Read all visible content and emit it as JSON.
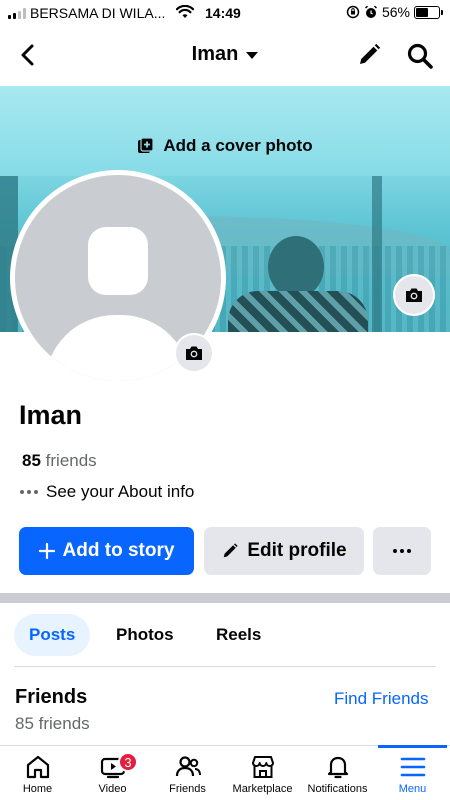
{
  "status_bar": {
    "carrier": "BERSAMA DI WILA...",
    "time": "14:49",
    "battery": "56%",
    "battery_level": 0.56
  },
  "header": {
    "title": "Iman"
  },
  "cover": {
    "add_cover_label": "Add a cover photo"
  },
  "profile": {
    "name": "Iman",
    "friends_number": "85",
    "friends_word": "friends",
    "about_label": "See your About info"
  },
  "actions": {
    "add_story": "Add to story",
    "edit_profile": "Edit profile"
  },
  "tabs": [
    {
      "label": "Posts",
      "active": true
    },
    {
      "label": "Photos",
      "active": false
    },
    {
      "label": "Reels",
      "active": false
    }
  ],
  "friends_section": {
    "title": "Friends",
    "find_friends": "Find Friends",
    "subtitle": "85 friends"
  },
  "bottom_nav": [
    {
      "label": "Home",
      "icon": "home-icon"
    },
    {
      "label": "Video",
      "icon": "video-icon",
      "badge": "3"
    },
    {
      "label": "Friends",
      "icon": "friends-icon"
    },
    {
      "label": "Marketplace",
      "icon": "marketplace-icon"
    },
    {
      "label": "Notifications",
      "icon": "bell-icon"
    },
    {
      "label": "Menu",
      "icon": "menu-icon",
      "active": true
    }
  ],
  "colors": {
    "accent": "#0866ff",
    "badge": "#e41e3f",
    "secondary_button": "#e4e6eb"
  }
}
